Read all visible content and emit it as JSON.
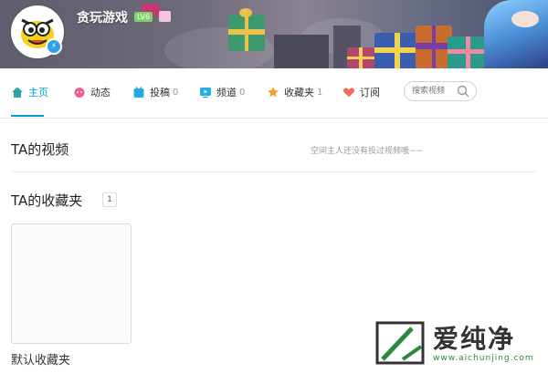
{
  "header": {
    "username": "贪玩游戏",
    "level": "LV6",
    "colors": {
      "accent": "#00a1d6",
      "verify": "#2fa3e0"
    }
  },
  "nav": {
    "items": [
      {
        "label": "主页",
        "count": "",
        "icon": "home-icon",
        "active": true
      },
      {
        "label": "动态",
        "count": "",
        "icon": "dynamic-icon"
      },
      {
        "label": "投稿",
        "count": "0",
        "icon": "upload-icon"
      },
      {
        "label": "频道",
        "count": "0",
        "icon": "channel-icon"
      },
      {
        "label": "收藏夹",
        "count": "1",
        "icon": "star-icon"
      },
      {
        "label": "订阅",
        "count": "",
        "icon": "heart-icon"
      }
    ],
    "search_placeholder": "搜索视频"
  },
  "videos": {
    "title": "TA的视频",
    "empty_text": "空间主人还没有投过视频哦~~"
  },
  "favorites": {
    "title": "TA的收藏夹",
    "count": "1",
    "folder_name": "默认收藏夹"
  },
  "watermark": {
    "text": "爱纯净",
    "url": "www.aichunjing.com"
  }
}
